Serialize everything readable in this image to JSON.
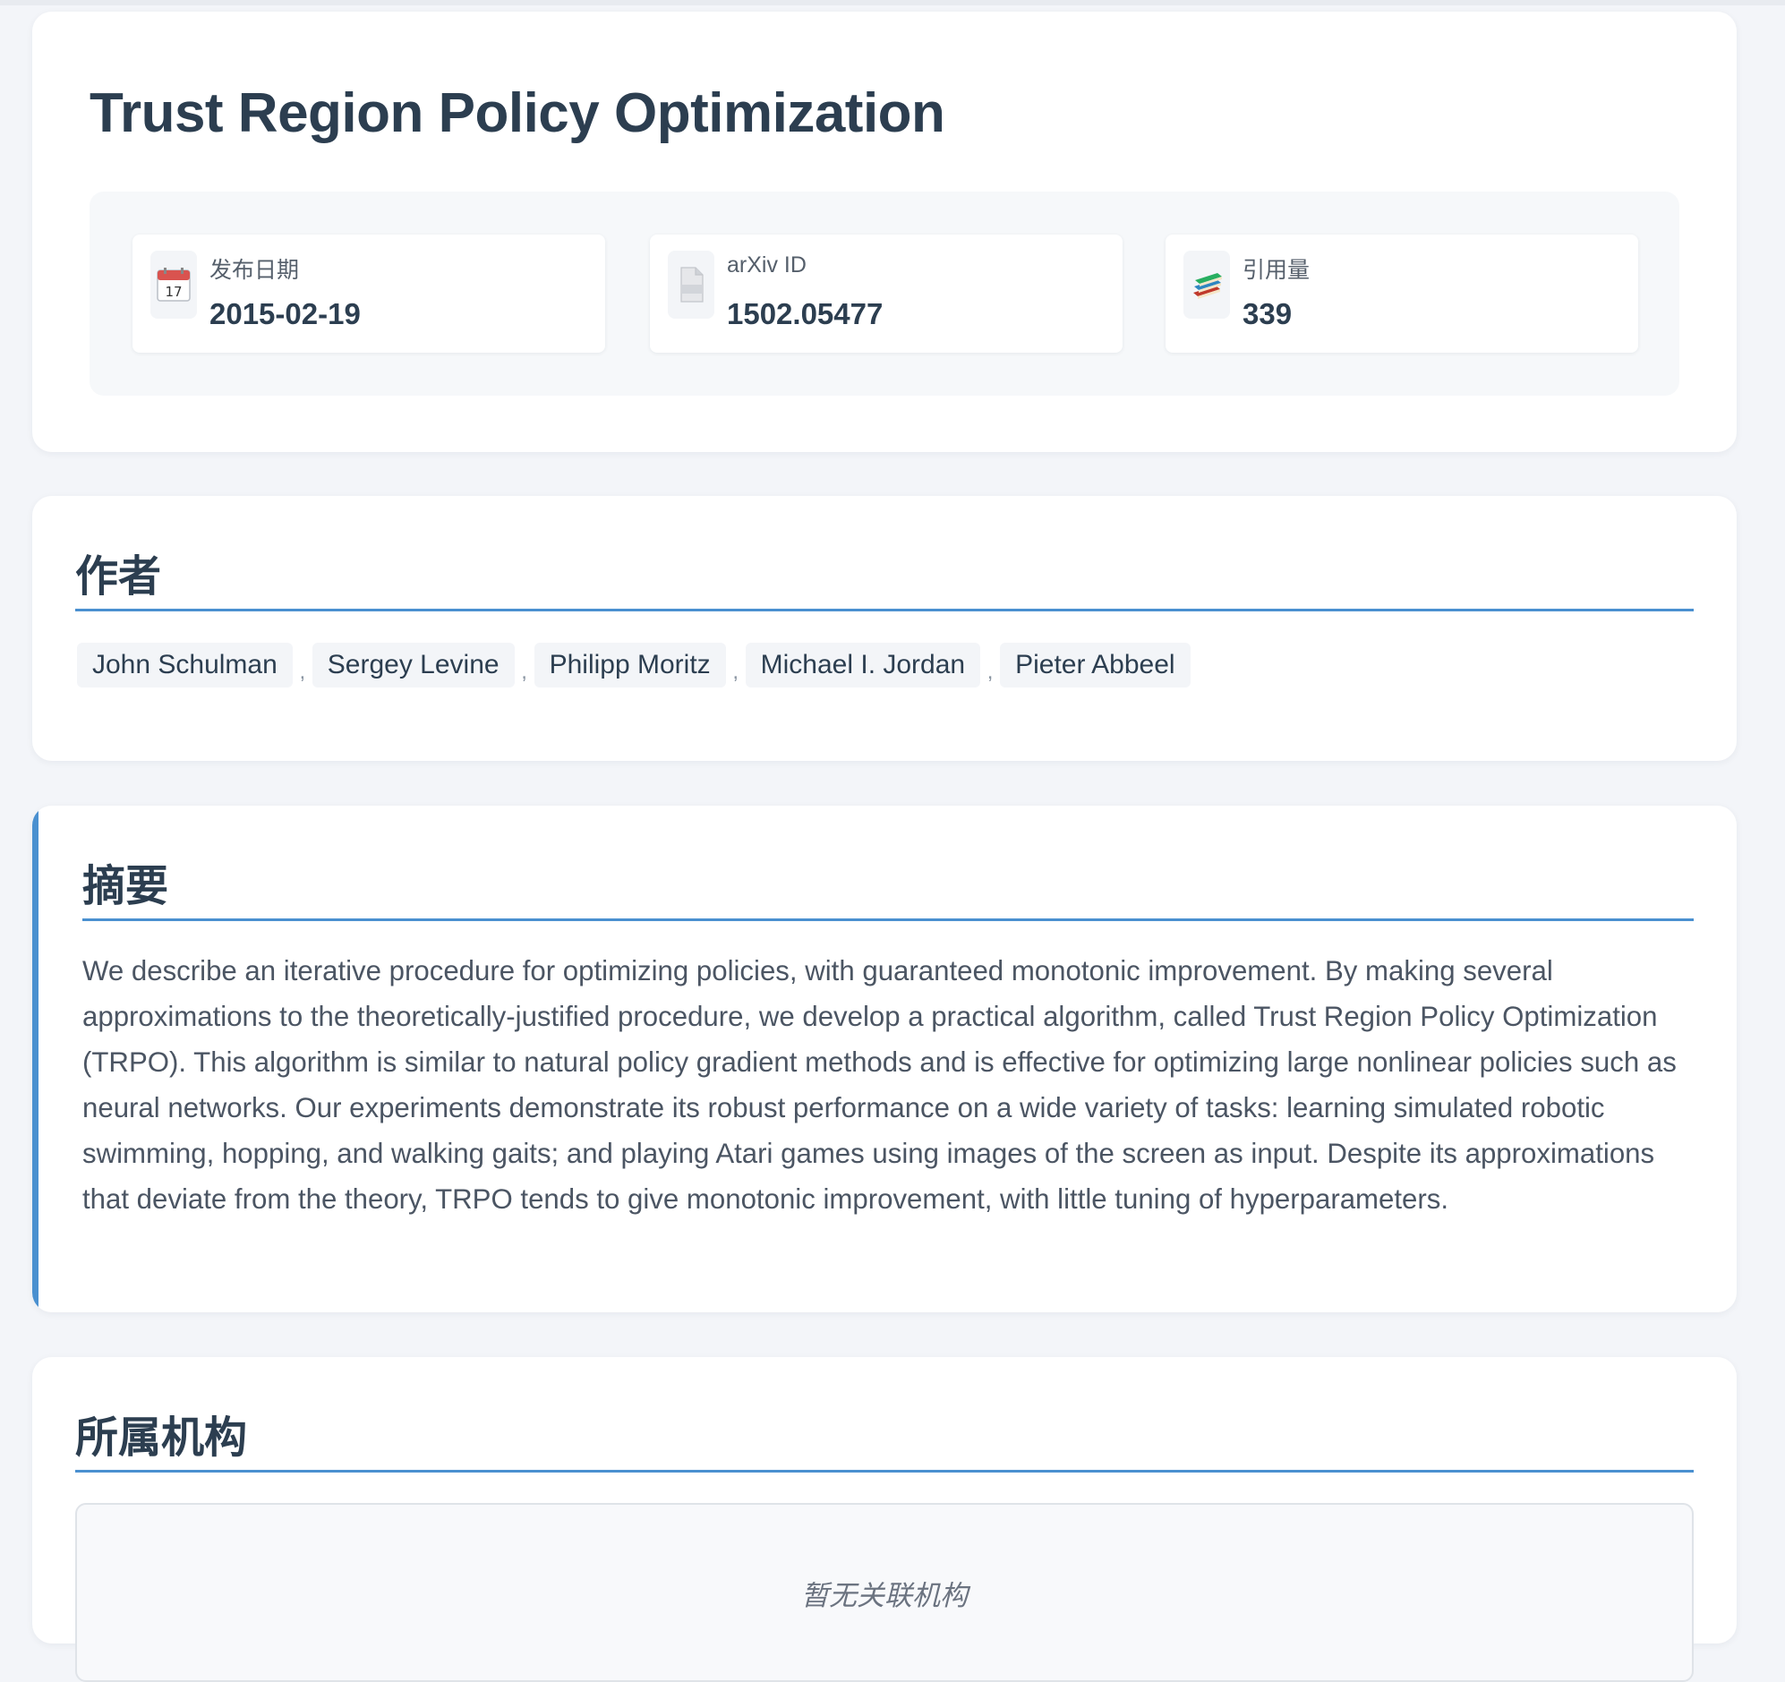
{
  "paper": {
    "title": "Trust Region Policy Optimization"
  },
  "meta": {
    "date": {
      "icon": "calendar-icon",
      "label": "发布日期",
      "value": "2015-02-19"
    },
    "arxiv": {
      "icon": "document-icon",
      "label": "arXiv ID",
      "value": "1502.05477"
    },
    "citations": {
      "icon": "books-icon",
      "label": "引用量",
      "value": "339"
    }
  },
  "authors_section": {
    "title": "作者",
    "separator": ",",
    "authors": [
      "John Schulman",
      "Sergey Levine",
      "Philipp Moritz",
      "Michael I. Jordan",
      "Pieter Abbeel"
    ]
  },
  "abstract_section": {
    "title": "摘要",
    "text": "We describe an iterative procedure for optimizing policies, with guaranteed monotonic improvement. By making several approximations to the theoretically-justified procedure, we develop a practical algorithm, called Trust Region Policy Optimization (TRPO). This algorithm is similar to natural policy gradient methods and is effective for optimizing large nonlinear policies such as neural networks. Our experiments demonstrate its robust performance on a wide variety of tasks: learning simulated robotic swimming, hopping, and walking gaits; and playing Atari games using images of the screen as input. Despite its approximations that deviate from the theory, TRPO tends to give monotonic improvement, with little tuning of hyperparameters."
  },
  "affiliation_section": {
    "title": "所属机构",
    "empty_text": "暂无关联机构"
  },
  "colors": {
    "accent": "#4a90d0",
    "heading": "#2c3e50",
    "background": "#f3f5f9"
  }
}
